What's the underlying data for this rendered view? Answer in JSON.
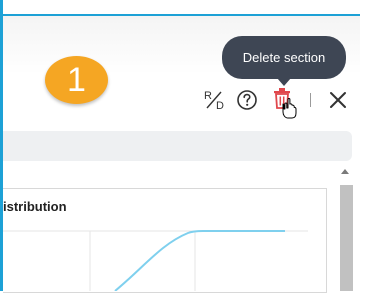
{
  "overlay": {
    "step_number": "1",
    "step_color": "#f5a623",
    "focus_border_color": "#1da1d6"
  },
  "tooltip": {
    "text": "Delete section"
  },
  "toolbar": {
    "rd_label_r": "R",
    "rd_label_d": "D",
    "icons": [
      "rd-icon",
      "help-icon",
      "trash-icon",
      "close-icon"
    ],
    "trash_color": "#e0474c"
  },
  "chart": {
    "title": "istribution",
    "line_color": "#7fd0ee"
  }
}
